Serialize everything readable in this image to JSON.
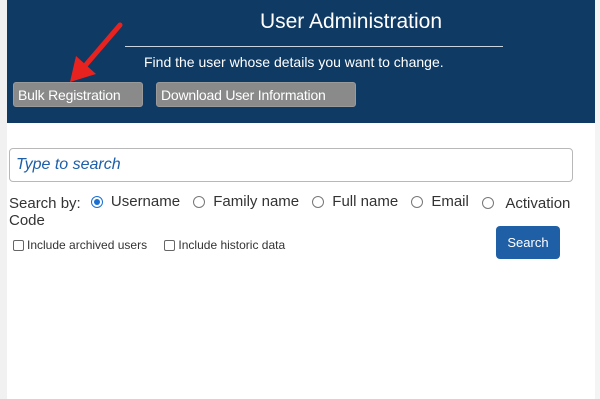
{
  "header": {
    "title": "User Administration",
    "subtitle": "Find the user whose details you want to change.",
    "buttons": {
      "bulk_registration": "Bulk Registration",
      "download_user_info": "Download User Information"
    },
    "background_color": "#0f3a63"
  },
  "annotation": {
    "arrow_color": "#e8231f",
    "points_to": "Bulk Registration"
  },
  "search": {
    "placeholder": "Type to search",
    "search_by_label": "Search by:",
    "options": [
      {
        "label": "Username",
        "checked": true
      },
      {
        "label": "Family name",
        "checked": false
      },
      {
        "label": "Full name",
        "checked": false
      },
      {
        "label": "Email",
        "checked": false
      },
      {
        "label": "Activation Code",
        "checked": false
      }
    ],
    "checkboxes": [
      {
        "label": "Include archived users",
        "checked": false
      },
      {
        "label": "Include historic data",
        "checked": false
      }
    ],
    "button_label": "Search",
    "accent_color": "#1f5fa6"
  }
}
